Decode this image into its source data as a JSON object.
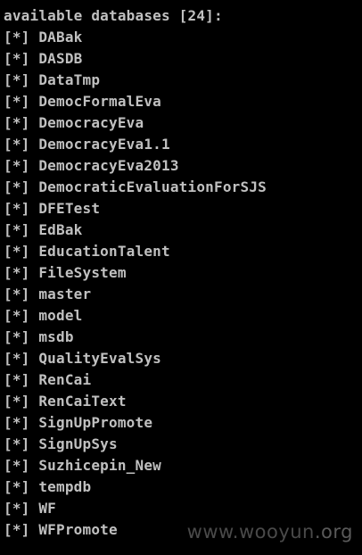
{
  "console": {
    "header": "available databases [24]:",
    "bullet": "[*]",
    "databases": [
      "DABak",
      "DASDB",
      "DataTmp",
      "DemocFormalEva",
      "DemocracyEva",
      "DemocracyEva1.1",
      "DemocracyEva2013",
      "DemocraticEvaluationForSJS",
      "DFETest",
      "EdBak",
      "EducationTalent",
      "FileSystem",
      "master",
      "model",
      "msdb",
      "QualityEvalSys",
      "RenCai",
      "RenCaiText",
      "SignUpPromote",
      "SignUpSys",
      "Suzhicepin_New",
      "tempdb",
      "WF",
      "WFPromote"
    ]
  },
  "watermark": {
    "site": "www.wooyun",
    "tld": ".org"
  },
  "colors": {
    "background": "#000000",
    "text": "#c0c0c0",
    "watermark": "#4a4a4a"
  }
}
